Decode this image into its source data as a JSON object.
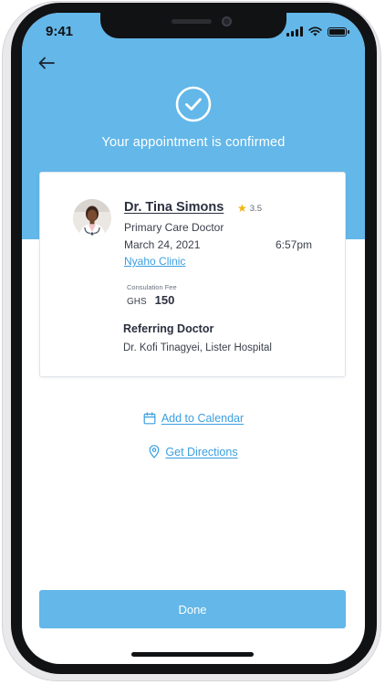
{
  "status_bar": {
    "time": "9:41"
  },
  "header": {
    "back_icon": "arrow-left-icon",
    "check_icon": "check-circle-icon",
    "confirmation_text": "Your appointment is confirmed",
    "background_color": "#63b7e9"
  },
  "appointment": {
    "doctor_name": "Dr. Tina Simons",
    "rating": "3.5",
    "specialty": "Primary Care Doctor",
    "date": "March 24, 2021",
    "time": "6:57pm",
    "clinic": "Nyaho Clinic",
    "fee_label": "Consulation Fee",
    "fee_currency": "GHS",
    "fee_amount": "150",
    "referring_title": "Referring Doctor",
    "referring_name": "Dr. Kofi Tinagyei, Lister Hospital"
  },
  "actions": {
    "calendar_label": "Add to Calendar",
    "calendar_icon": "calendar-icon",
    "directions_label": "Get Directions",
    "directions_icon": "location-pin-icon",
    "done_label": "Done"
  },
  "colors": {
    "accent": "#63b7e9",
    "link": "#3a9fe0",
    "star": "#f2b50c"
  }
}
